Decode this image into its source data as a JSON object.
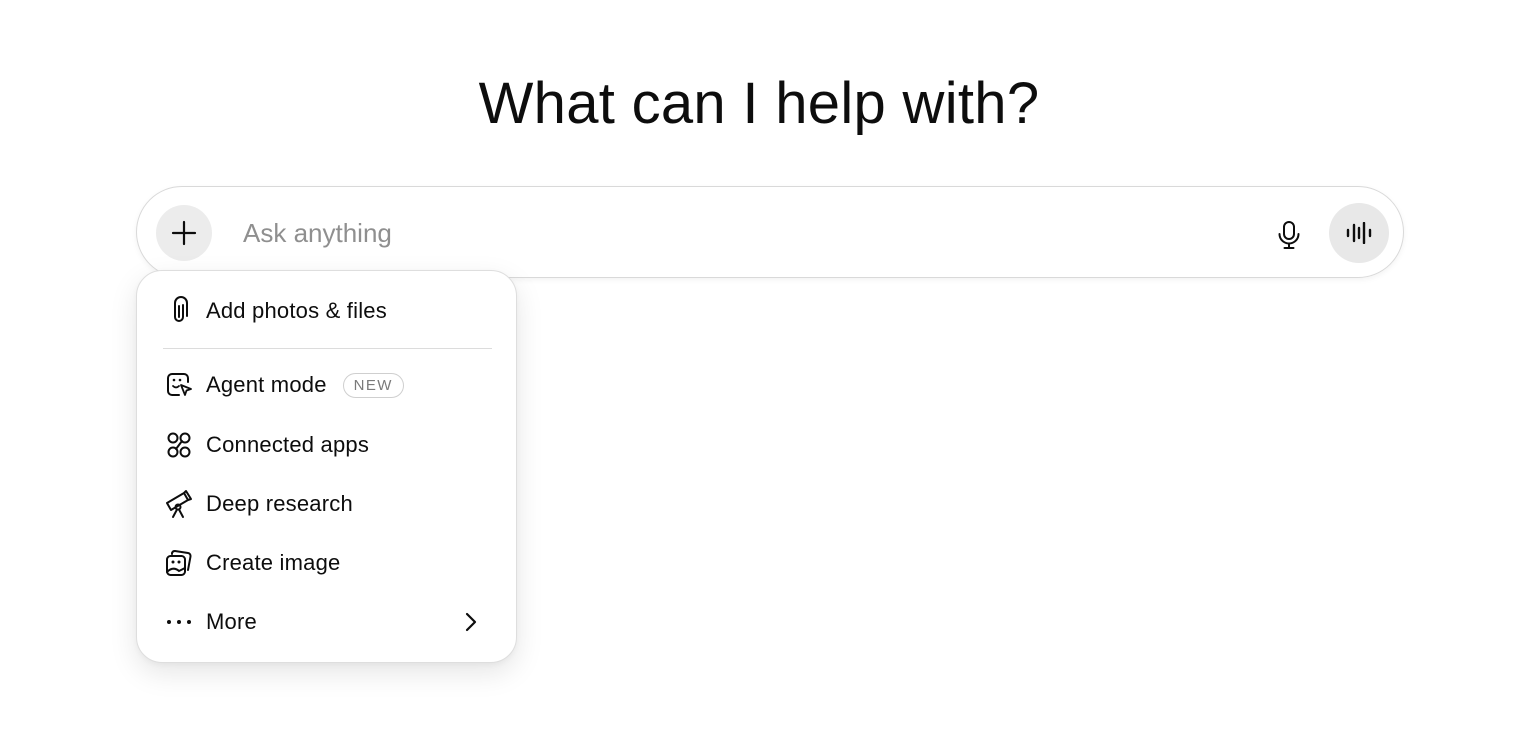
{
  "heading": "What can I help with?",
  "composer": {
    "placeholder": "Ask anything",
    "add_icon": "plus-icon",
    "mic_icon": "microphone-icon",
    "voice_icon": "voice-waveform-icon"
  },
  "menu": {
    "items": [
      {
        "label": "Add photos & files",
        "icon": "paperclip-icon"
      },
      {
        "label": "Agent mode",
        "icon": "agent-cursor-icon",
        "badge": "NEW"
      },
      {
        "label": "Connected apps",
        "icon": "connected-apps-icon"
      },
      {
        "label": "Deep research",
        "icon": "telescope-icon"
      },
      {
        "label": "Create image",
        "icon": "image-icon"
      },
      {
        "label": "More",
        "icon": "ellipsis-icon",
        "trailing_icon": "chevron-right-icon"
      }
    ]
  },
  "colors": {
    "text": "#0d0d0d",
    "placeholder": "#8f8f8f",
    "button_bg": "#ececec",
    "border": "#d9d9d9"
  }
}
